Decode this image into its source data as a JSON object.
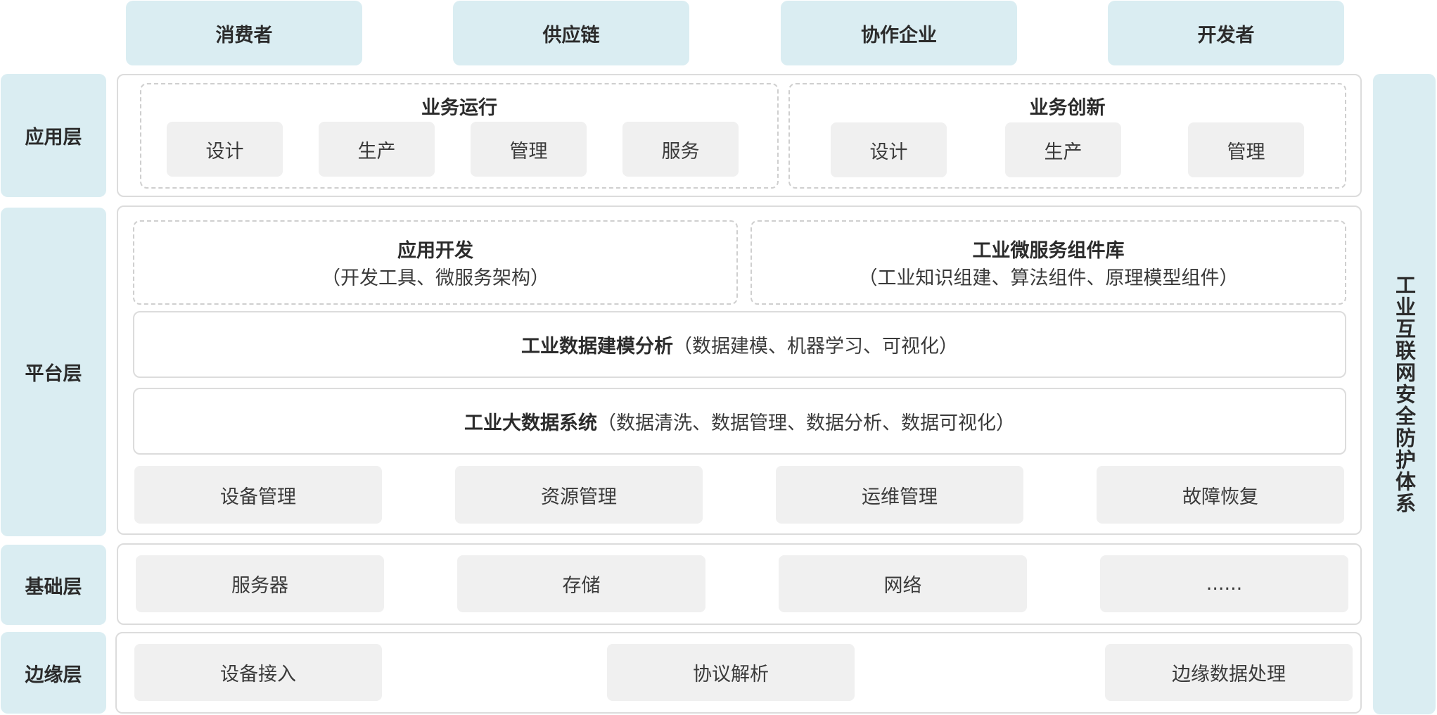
{
  "top_roles": [
    "消费者",
    "供应链",
    "协作企业",
    "开发者"
  ],
  "layers": {
    "app": "应用层",
    "platform": "平台层",
    "foundation": "基础层",
    "edge": "边缘层"
  },
  "security": "工业互联网安全防护体系",
  "app_layer": {
    "ops": {
      "title": "业务运行",
      "items": [
        "设计",
        "生产",
        "管理",
        "服务"
      ]
    },
    "innovation": {
      "title": "业务创新",
      "items": [
        "设计",
        "生产",
        "管理"
      ]
    }
  },
  "platform_layer": {
    "app_dev": {
      "title": "应用开发",
      "sub": "（开发工具、微服务架构）"
    },
    "micro": {
      "title": "工业微服务组件库",
      "sub": "（工业知识组建、算法组件、原理模型组件）"
    },
    "modeling": {
      "title": "工业数据建模分析",
      "sub": "（数据建模、机器学习、可视化）"
    },
    "bigdata": {
      "title": "工业大数据系统",
      "sub": "（数据清洗、数据管理、数据分析、数据可视化）"
    },
    "items": [
      "设备管理",
      "资源管理",
      "运维管理",
      "故障恢复"
    ]
  },
  "foundation_layer": {
    "items": [
      "服务器",
      "存储",
      "网络",
      "......"
    ]
  },
  "edge_layer": {
    "items": [
      "设备接入",
      "协议解析",
      "边缘数据处理"
    ]
  }
}
